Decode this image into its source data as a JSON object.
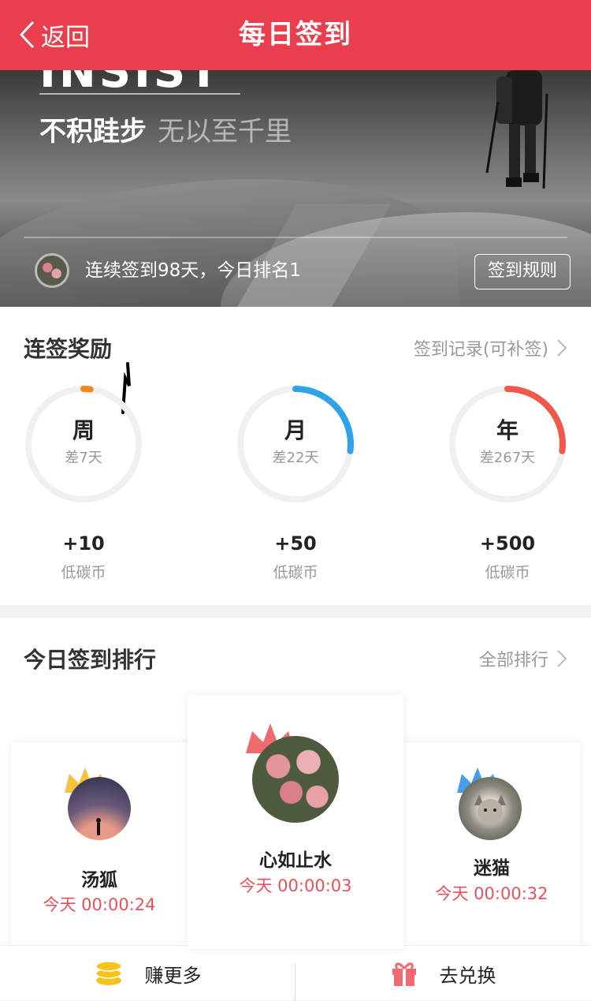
{
  "header": {
    "back_label": "返回",
    "title": "每日签到"
  },
  "banner": {
    "heading": "INSIST",
    "slogan_main": "不积跬步",
    "slogan_sub": "无以至千里",
    "streak_text": "连续签到98天，今日排名1",
    "rule_button": "签到规则"
  },
  "reward": {
    "title": "连签奖励",
    "record_link": "签到记录(可补签)",
    "rings": [
      {
        "label": "周",
        "remaining": "差7天",
        "bonus": "+10",
        "unit": "低碳币",
        "color": "#f6871f",
        "progress": 0.02
      },
      {
        "label": "月",
        "remaining": "差22天",
        "bonus": "+50",
        "unit": "低碳币",
        "color": "#2ea3ea",
        "progress": 0.27
      },
      {
        "label": "年",
        "remaining": "差267天",
        "bonus": "+500",
        "unit": "低碳币",
        "color": "#f2574c",
        "progress": 0.27
      }
    ]
  },
  "ranking": {
    "title": "今日签到排行",
    "all_link": "全部排行",
    "entries": [
      {
        "rank": 2,
        "name": "汤狐",
        "time": "今天 00:00:24",
        "crown_color": "#f5c33b"
      },
      {
        "rank": 1,
        "name": "心如止水",
        "time": "今天 00:00:03",
        "crown_color": "#f06a70"
      },
      {
        "rank": 3,
        "name": "迷猫",
        "time": "今天 00:00:32",
        "crown_color": "#4a9be8"
      }
    ]
  },
  "bottom_bar": {
    "earn_label": "赚更多",
    "redeem_label": "去兑换"
  }
}
